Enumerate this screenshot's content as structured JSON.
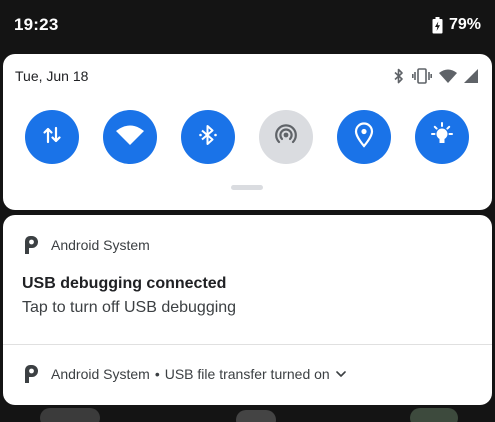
{
  "status_bar": {
    "time": "19:23",
    "battery_percent": "79%",
    "battery_icon": "battery-charging-icon"
  },
  "quick_settings": {
    "date": "Tue, Jun 18",
    "status_icons": [
      "bluetooth-icon",
      "vibrate-icon",
      "wifi-signal-icon",
      "cell-signal-icon"
    ],
    "tiles": [
      {
        "icon": "mobile-data-icon",
        "state": "on"
      },
      {
        "icon": "wifi-icon",
        "state": "on"
      },
      {
        "icon": "bluetooth-icon",
        "state": "on"
      },
      {
        "icon": "hotspot-icon",
        "state": "off"
      },
      {
        "icon": "location-icon",
        "state": "on"
      },
      {
        "icon": "flashlight-icon",
        "state": "on"
      }
    ],
    "colors": {
      "active": "#1a73e8",
      "inactive": "#dadce0"
    }
  },
  "notification": {
    "app_name": "Android System",
    "title": "USB debugging connected",
    "text": "Tap to turn off USB debugging"
  },
  "collapsed_notification": {
    "app_name": "Android System",
    "separator": "•",
    "text": "USB file transfer turned on"
  }
}
